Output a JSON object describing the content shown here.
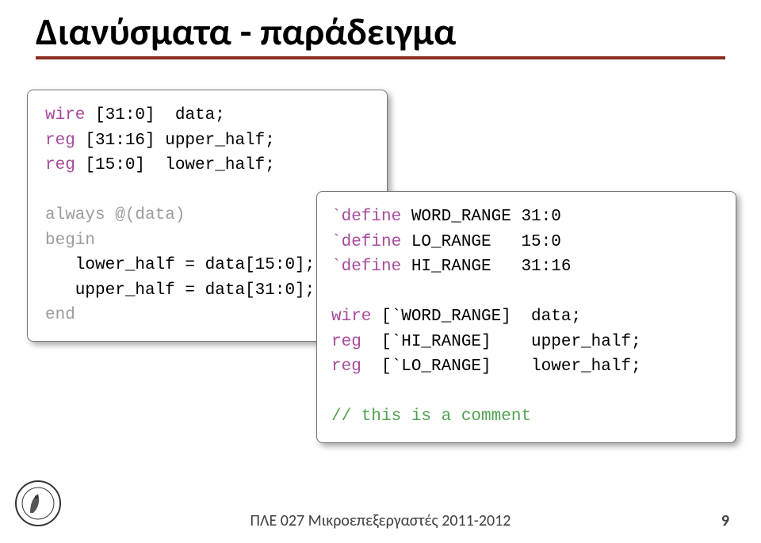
{
  "title": "Διανύσματα - παράδειγμα",
  "code1": {
    "l1a": "wire",
    "l1b": " [31:0]  data;",
    "l2a": "reg",
    "l2b": " [31:16] upper_half;",
    "l3a": "reg",
    "l3b": " [15:0]  lower_half;",
    "blank": "",
    "l4a": "always",
    "l4b": " @(data)",
    "l5": "begin",
    "l6": "   lower_half = data[15:0];",
    "l7": "   upper_half = data[31:0];",
    "l8": "end"
  },
  "code2": {
    "l1a": "`define",
    "l1b": " WORD_RANGE 31:0",
    "l2a": "`define",
    "l2b": " LO_RANGE   15:0",
    "l3a": "`define",
    "l3b": " HI_RANGE   31:16",
    "blank": "",
    "l4a": "wire",
    "l4b": " [`WORD_RANGE]  data;",
    "l5a": "reg",
    "l5b": "  [`HI_RANGE]    upper_half;",
    "l6a": "reg",
    "l6b": "  [`LO_RANGE]    lower_half;",
    "l7": "// this is a comment"
  },
  "footer": "ΠΛΕ 027 Μικροεπεξεργαστές  2011-2012",
  "page": "9"
}
